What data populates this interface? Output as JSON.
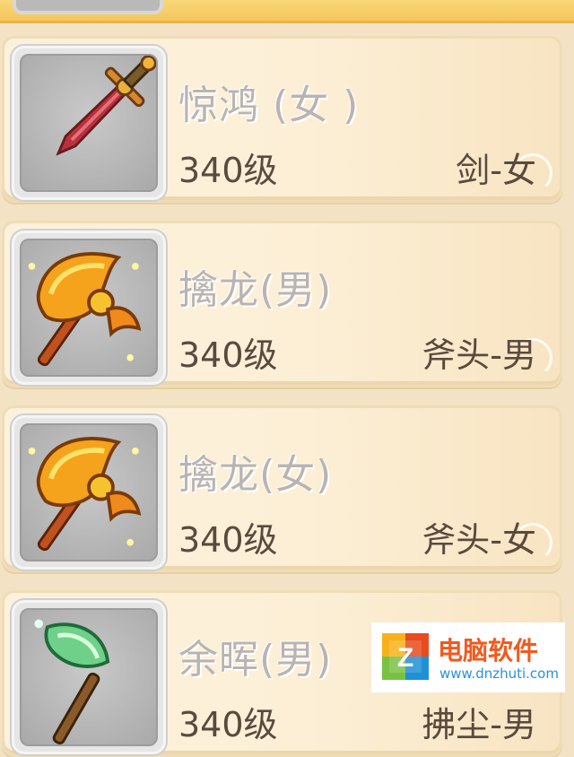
{
  "items": [
    {
      "name": "惊鸿 (女 )",
      "level": "340级",
      "weapon_type": "剑-女",
      "icon": "sword-icon"
    },
    {
      "name": "擒龙(男)",
      "level": "340级",
      "weapon_type": "斧头-男",
      "icon": "axe-icon"
    },
    {
      "name": "擒龙(女)",
      "level": "340级",
      "weapon_type": "斧头-女",
      "icon": "axe-icon"
    },
    {
      "name": "余晖(男)",
      "level": "340级",
      "weapon_type": "拂尘-男",
      "icon": "whisk-icon"
    }
  ],
  "watermark": {
    "title": "电脑软件",
    "url": "www.dnzhuti.com",
    "logo_letter": "Z"
  },
  "colors": {
    "name_text": "#b9b4b2",
    "detail_text": "#5a4a3e",
    "brand_orange": "#f05a1e",
    "brand_blue": "#2b90d9"
  }
}
